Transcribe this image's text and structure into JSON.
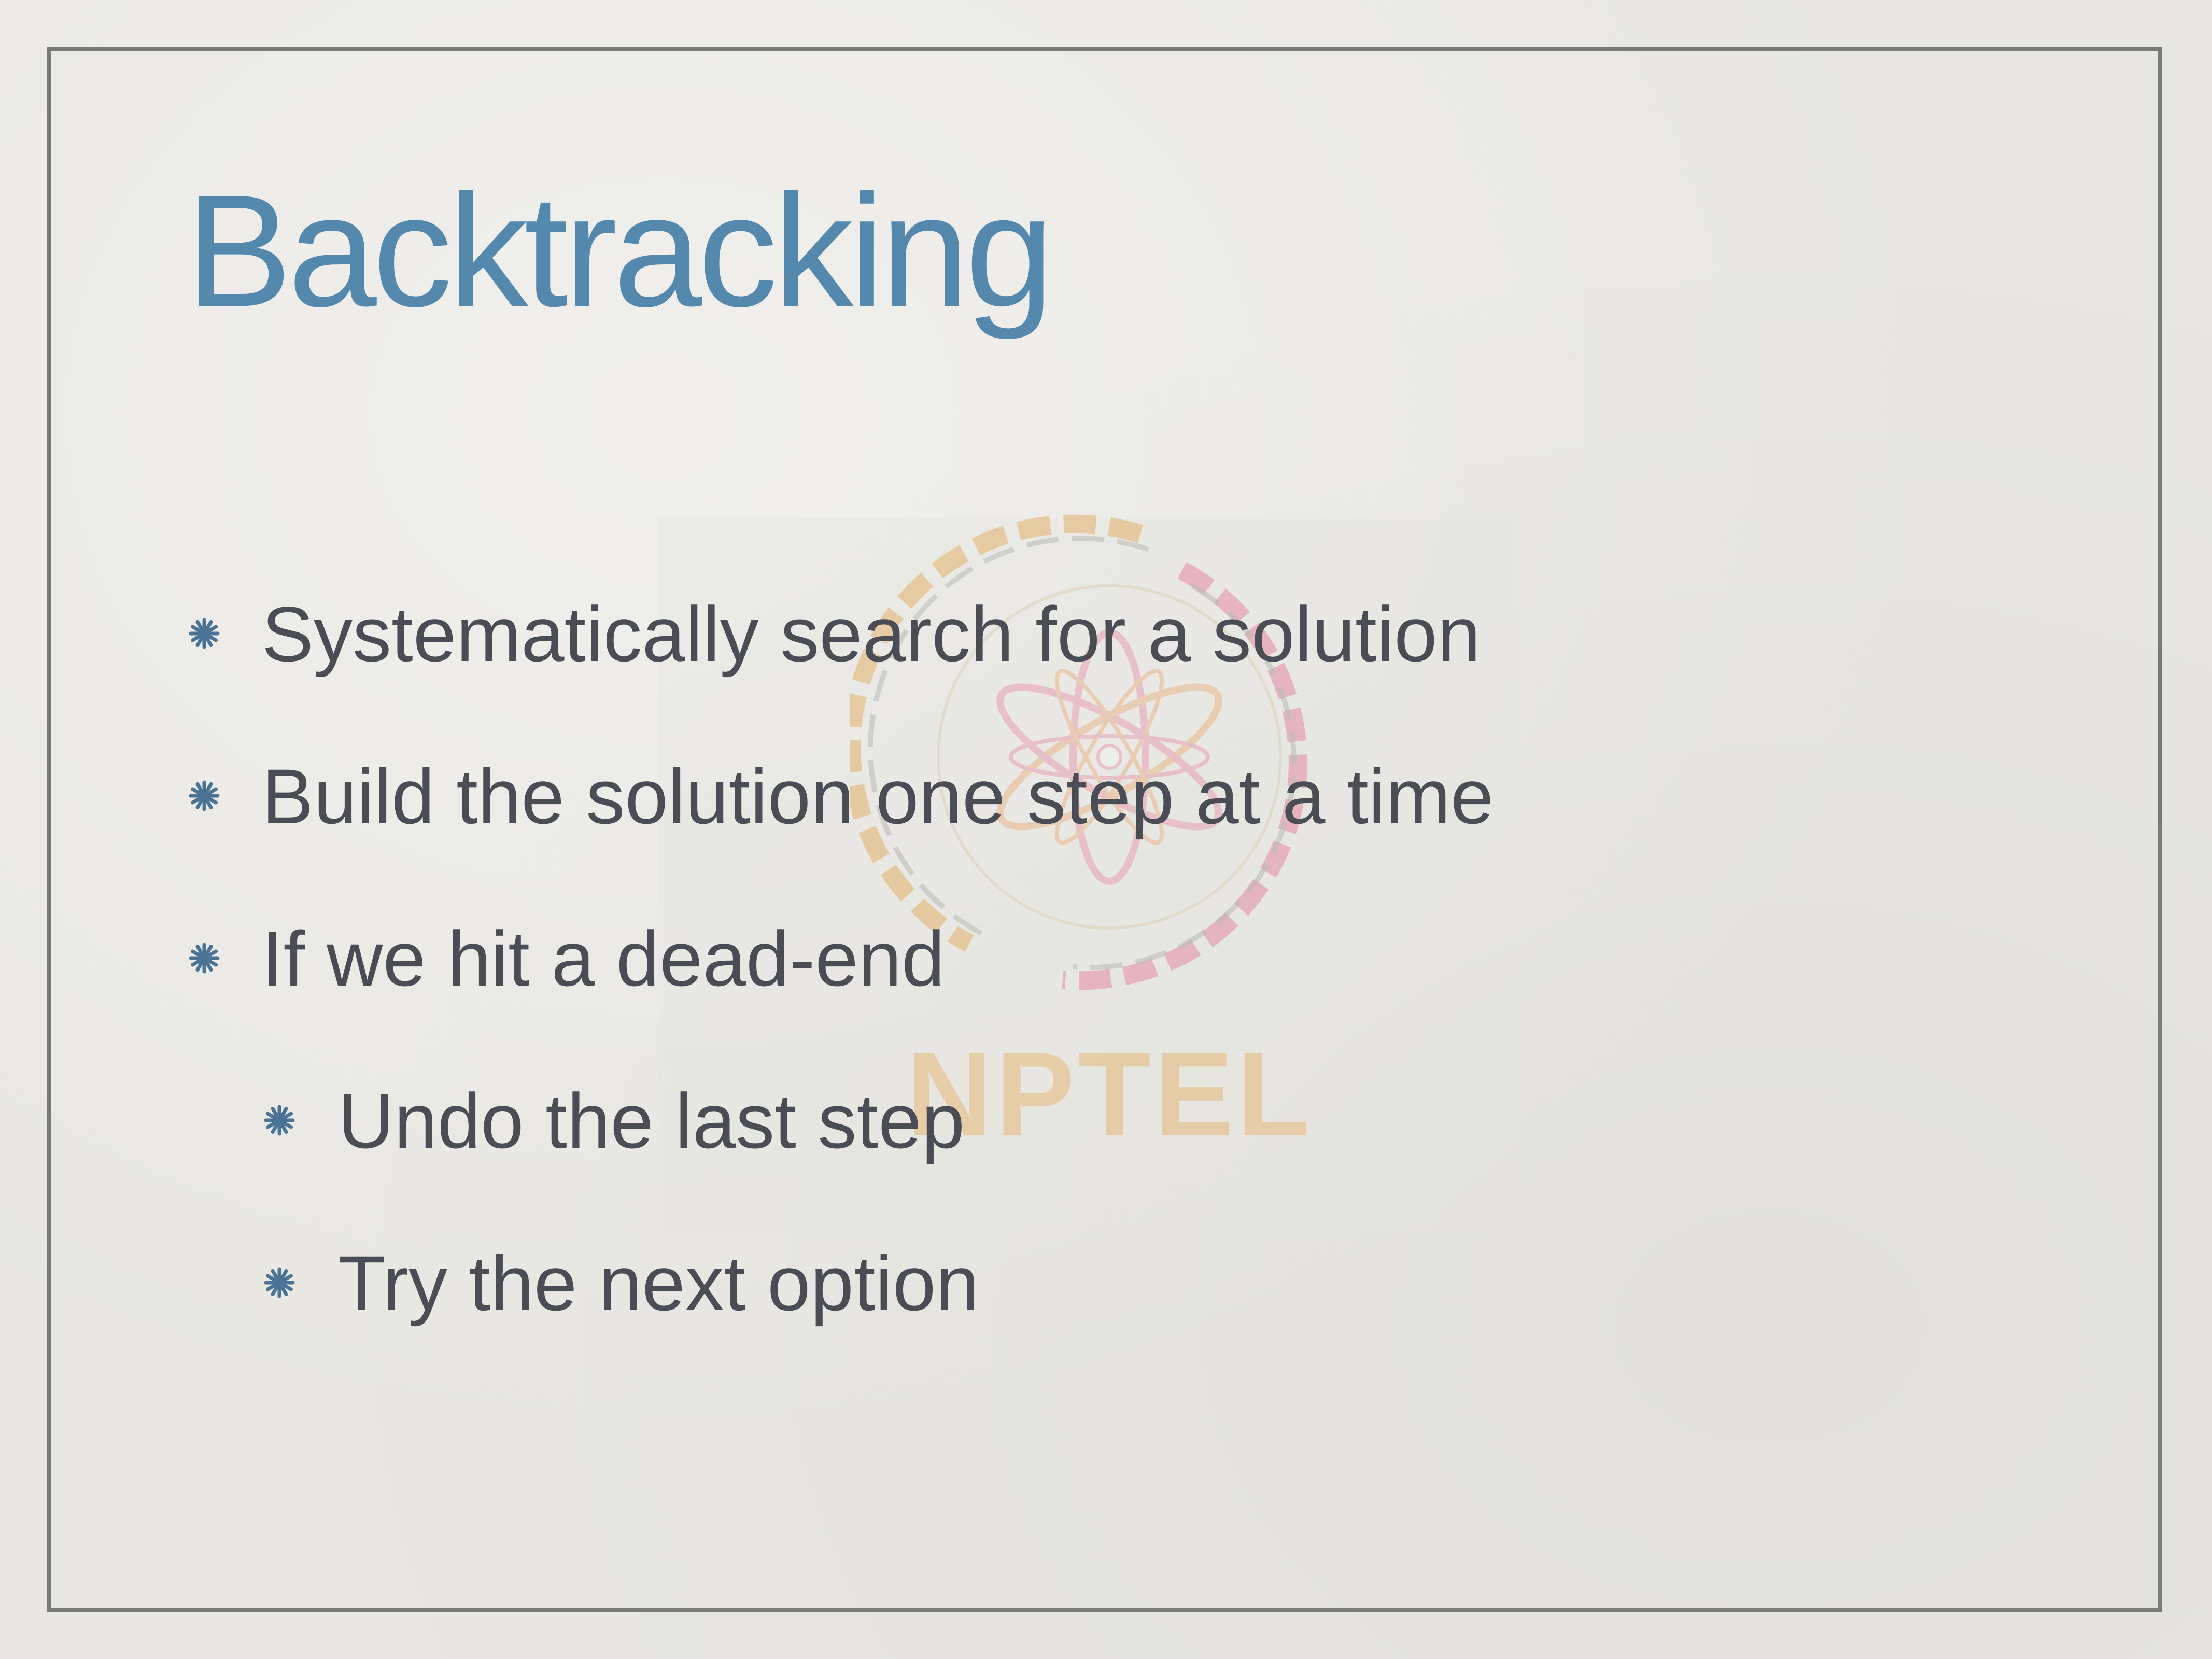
{
  "slide": {
    "title": "Backtracking",
    "bullets": [
      {
        "text": "Systematically search for a solution",
        "level": 1
      },
      {
        "text": "Build the solution one step at a time",
        "level": 1
      },
      {
        "text": "If we hit a dead-end",
        "level": 1
      },
      {
        "text": "Undo the last step",
        "level": 2
      },
      {
        "text": "Try the next option",
        "level": 2
      }
    ]
  },
  "watermark": {
    "logo": "nptel-logo",
    "text": "NPTEL"
  },
  "colors": {
    "title": "#5488ad",
    "body_text": "#4a4d56",
    "bullet_mark": "#4a7396",
    "frame": "#7a7a78",
    "background": "#e8e7e2",
    "watermark_orange": "#e8b876",
    "watermark_pink": "#e08aa0"
  },
  "icons": {
    "bullet": "asterisk-bullet-icon"
  }
}
